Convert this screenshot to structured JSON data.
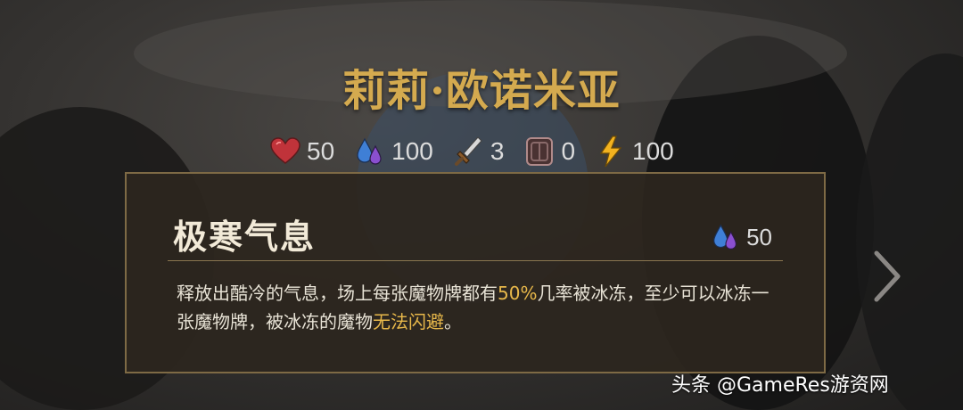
{
  "hero": {
    "name": "莉莉·欧诺米亚"
  },
  "stats": [
    {
      "icon": "heart-icon",
      "value": "50"
    },
    {
      "icon": "mana-drops-icon",
      "value": "100"
    },
    {
      "icon": "sword-icon",
      "value": "3"
    },
    {
      "icon": "shield-icon",
      "value": "0"
    },
    {
      "icon": "lightning-icon",
      "value": "100"
    }
  ],
  "skill": {
    "title": "极寒气息",
    "cost": "50",
    "desc_part1": "释放出酷冷的气息，场上每张魔物牌都有",
    "desc_hl1": "50%",
    "desc_part2": "几率被冰冻，至少可以冰冻一张魔物牌，被冰冻的魔物",
    "desc_hl2": "无法闪避",
    "desc_part3": "。"
  },
  "watermark": "头条 @GameRes游资网",
  "colors": {
    "gold": "#d4aa4f",
    "highlight": "#e8b84a",
    "card_border": "#7e6a45"
  }
}
